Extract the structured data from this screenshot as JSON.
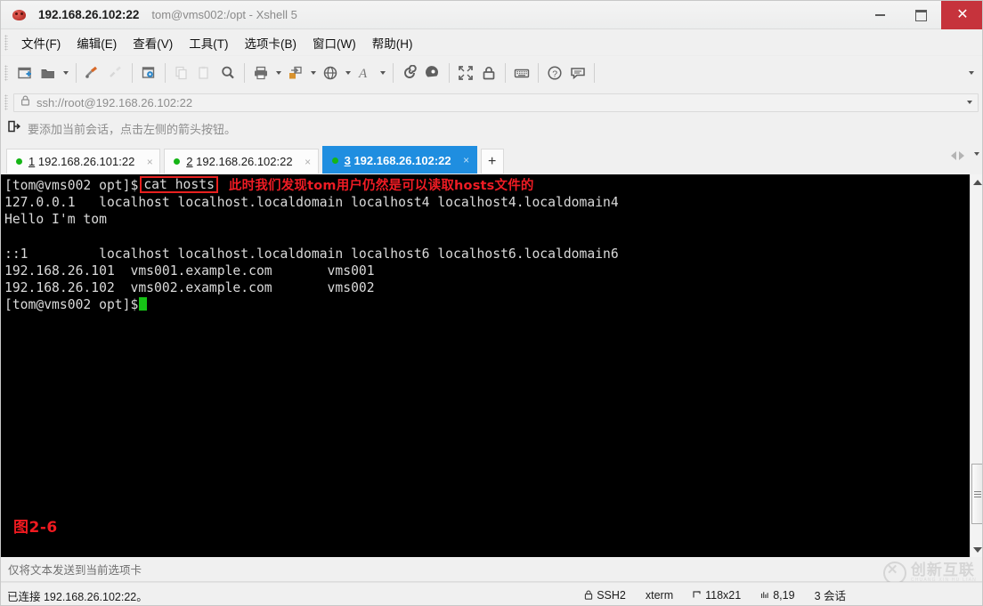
{
  "window": {
    "title_main": "192.168.26.102:22",
    "title_sub": "tom@vms002:/opt - Xshell 5",
    "app_icon": "xshell-app-icon",
    "controls": {
      "minimize": "minimize-button",
      "maximize": "maximize-button",
      "close_label": "✕"
    }
  },
  "menubar": {
    "items": [
      {
        "label": "文件(F)",
        "name": "menu-file"
      },
      {
        "label": "编辑(E)",
        "name": "menu-edit"
      },
      {
        "label": "查看(V)",
        "name": "menu-view"
      },
      {
        "label": "工具(T)",
        "name": "menu-tools"
      },
      {
        "label": "选项卡(B)",
        "name": "menu-tab"
      },
      {
        "label": "窗口(W)",
        "name": "menu-window"
      },
      {
        "label": "帮助(H)",
        "name": "menu-help"
      }
    ]
  },
  "toolbar": {
    "icons": [
      "new-session-icon",
      "open-folder-icon",
      "connect-icon",
      "disconnect-icon",
      "properties-icon",
      "copy-icon",
      "paste-icon",
      "find-icon",
      "print-icon",
      "file-transfer-icon",
      "globe-icon",
      "font-icon",
      "sftp-icon",
      "tunnel-icon",
      "fullscreen-icon",
      "lock-icon",
      "keyboard-icon",
      "help-icon",
      "chat-icon"
    ],
    "overflow_icon": "chevron-down-icon"
  },
  "address_bar": {
    "lock_icon": "lock-icon",
    "value": "ssh://root@192.168.26.102:22",
    "placeholder": "ssh://",
    "dropdown_icon": "chevron-down-icon"
  },
  "hint_bar": {
    "icon": "add-session-arrow-icon",
    "text": "要添加当前会话，点击左侧的箭头按钮。"
  },
  "tabs": {
    "items": [
      {
        "num": "1",
        "label": "192.168.26.101:22",
        "active": false,
        "status": "connected",
        "close": "×"
      },
      {
        "num": "2",
        "label": "192.168.26.102:22",
        "active": false,
        "status": "connected",
        "close": "×"
      },
      {
        "num": "3",
        "label": "192.168.26.102:22",
        "active": true,
        "status": "connected",
        "close": "×"
      }
    ],
    "new_tab_label": "+",
    "nav_prev_icon": "chevron-left-icon",
    "nav_next_icon": "chevron-right-icon",
    "list_icon": "chevron-down-icon",
    "active_color": "#1f8ee0",
    "dot_color": "#15b516"
  },
  "terminal": {
    "prompt": "[tom@vms002 opt]$",
    "command": "cat hosts",
    "annotation": "此时我们发现tom用户仍然是可以读取hosts文件的",
    "lines": [
      "127.0.0.1   localhost localhost.localdomain localhost4 localhost4.localdomain4",
      "Hello I'm tom",
      "",
      "::1         localhost localhost.localdomain localhost6 localhost6.localdomain6",
      "192.168.26.101  vms001.example.com       vms001",
      "192.168.26.102  vms002.example.com       vms002"
    ],
    "final_prompt": "[tom@vms002 opt]$",
    "cursor_color": "#16c216",
    "figure_caption": "图2-6",
    "annotation_color": "#ee1c24",
    "scrollbar": {
      "up_icon": "scroll-up-arrow-icon",
      "down_icon": "scroll-down-arrow-icon",
      "thumb": "scrollbar-thumb"
    }
  },
  "send_bar": {
    "text": "仅将文本发送到当前选项卡"
  },
  "watermark": {
    "main": "创新互联",
    "sub": "CHUANG XIN HU LIAN",
    "logo": "circle-x-logo"
  },
  "statusbar": {
    "connection": "已连接 192.168.26.102:22。",
    "cells": [
      {
        "icon": "lock-icon",
        "label": "SSH2",
        "name": "status-protocol"
      },
      {
        "icon": "",
        "label": "xterm",
        "name": "status-terminal-type"
      },
      {
        "icon": "resize-icon",
        "label": "118x21",
        "name": "status-size"
      },
      {
        "icon": "cursor-pos-icon",
        "label": "8,19",
        "name": "status-cursor-position"
      },
      {
        "icon": "",
        "label": "3 会话",
        "name": "status-session-count"
      }
    ]
  }
}
